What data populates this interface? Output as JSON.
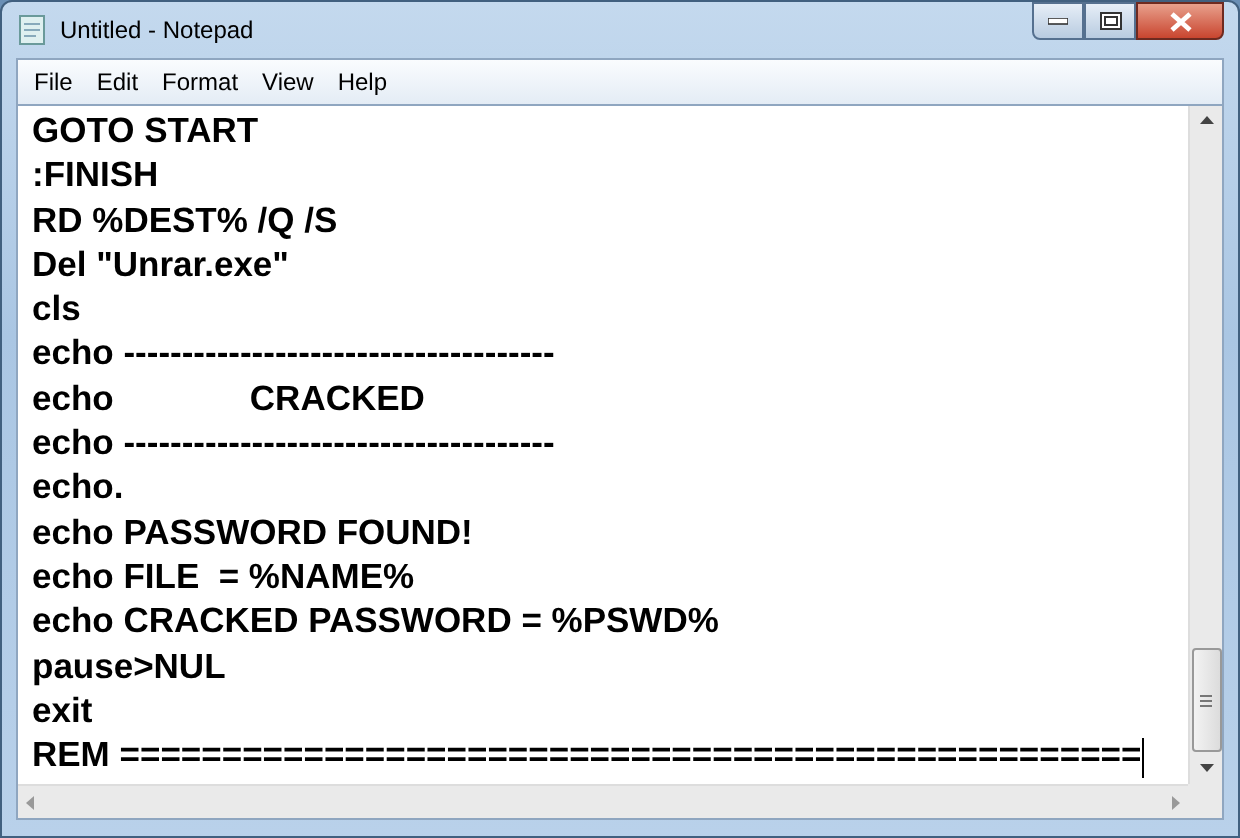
{
  "window": {
    "title": "Untitled - Notepad"
  },
  "menu": [
    "File",
    "Edit",
    "Format",
    "View",
    "Help"
  ],
  "lines": [
    "GOTO START",
    ":FINISH",
    "RD %DEST% /Q /S",
    "Del \"Unrar.exe\"",
    "cls",
    "echo -------------------------------------",
    "echo              CRACKED",
    "echo -------------------------------------",
    "echo.",
    "echo PASSWORD FOUND!",
    "echo FILE  = %NAME%",
    "echo CRACKED PASSWORD = %PSWD%",
    "pause>NUL",
    "exit",
    "REM =================================================="
  ]
}
